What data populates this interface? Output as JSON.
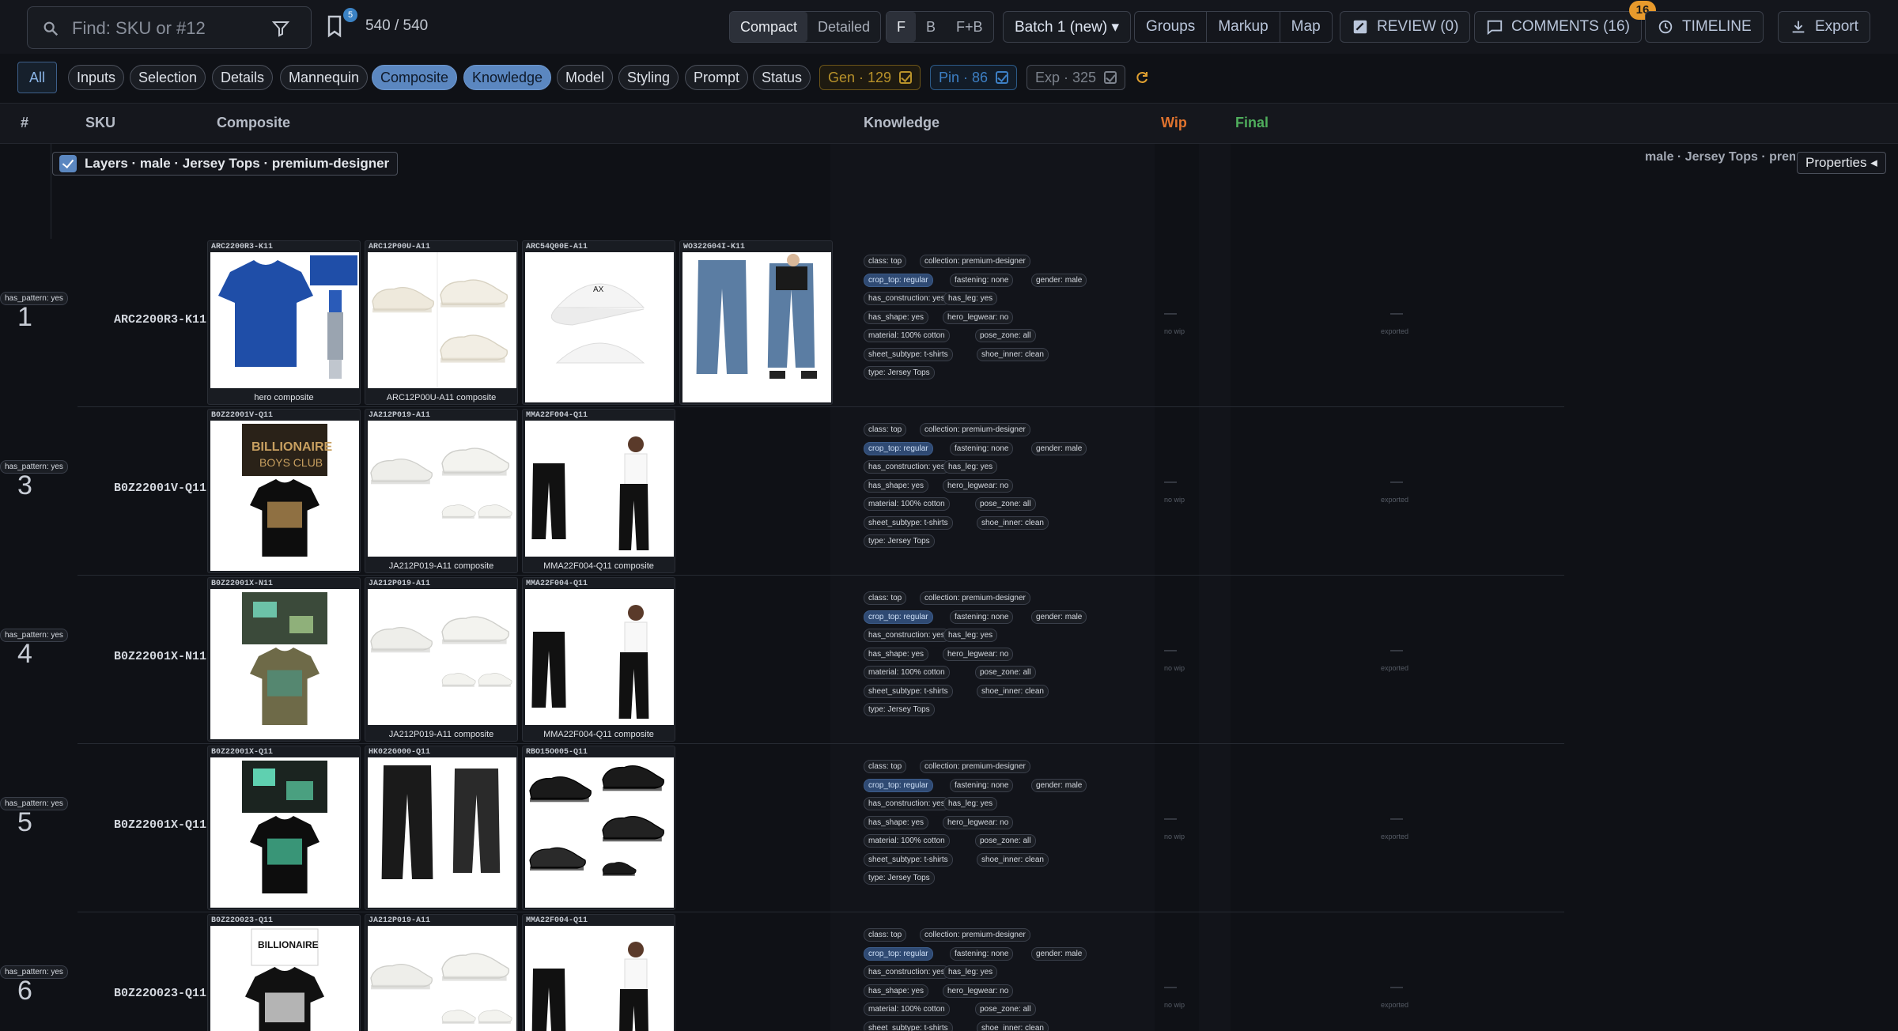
{
  "search": {
    "placeholder": "Find: SKU or #12"
  },
  "bookmarks": {
    "badge": "5"
  },
  "count": "540 / 540",
  "view_mode": {
    "compact": "Compact",
    "detailed": "Detailed"
  },
  "side": {
    "f": "F",
    "b": "B",
    "fb": "F+B"
  },
  "batch": "Batch 1 (new) ▾",
  "groups": {
    "groups": "Groups",
    "markup": "Markup",
    "map": "Map"
  },
  "review": "REVIEW (0)",
  "comments": {
    "label": "COMMENTS (16)",
    "badge": "16"
  },
  "timeline": "TIMELINE",
  "export": "Export",
  "filters": {
    "all": "All",
    "chips": [
      "Inputs",
      "Selection",
      "Details",
      "Mannequin",
      "Composite",
      "Knowledge",
      "Model",
      "Styling",
      "Prompt",
      "Status"
    ],
    "gen": "Gen · 129",
    "pin": "Pin · 86",
    "exp": "Exp · 325"
  },
  "columns": {
    "num": "#",
    "sku": "SKU",
    "composite": "Composite",
    "knowledge": "Knowledge",
    "wip": "Wip",
    "final": "Final"
  },
  "colors": {
    "wip": "#e0732e",
    "final": "#4fae5c",
    "accent": "#5b87c0",
    "gen": "#b8922a",
    "pin": "#3d7fc4",
    "exp": "#8a8f99"
  },
  "group": {
    "layers": "Layers · male · Jersey Tops · premium-designer",
    "crumb": "male · Jersey Tops · premium-designer",
    "properties": "Properties ◂"
  },
  "knowledge_tags": [
    "class: top",
    "collection: premium-designer",
    "crop_top: regular",
    "fastening: none",
    "gender: male",
    "has_construction: yes",
    "has_leg: yes",
    "has_pattern: yes",
    "has_shape: yes",
    "hero_legwear: no",
    "material: 100% cotton",
    "pose_zone: all",
    "sheet_subtype: t-shirts",
    "shoe_inner: clean",
    "type: Jersey Tops"
  ],
  "status": {
    "wip_dash": "—",
    "wip_text": "no wip",
    "final_dash": "—",
    "final_text": "exported"
  },
  "rows": [
    {
      "num": "1",
      "sku": "ARC2200R3-K11",
      "cards": [
        {
          "label": "ARC2200R3-K11",
          "caption": "hero composite"
        },
        {
          "label": "ARC12P00U-A11",
          "caption": "ARC12P00U-A11 composite"
        },
        {
          "label": "ARC54Q00E-A11",
          "caption": ""
        },
        {
          "label": "WO322G04I-K11",
          "caption": ""
        }
      ]
    },
    {
      "num": "3",
      "sku": "B0Z22001V-Q11",
      "cards": [
        {
          "label": "B0Z22001V-Q11",
          "caption": ""
        },
        {
          "label": "JA212P019-A11",
          "caption": "JA212P019-A11 composite"
        },
        {
          "label": "MMA22F004-Q11",
          "caption": "MMA22F004-Q11 composite"
        }
      ]
    },
    {
      "num": "4",
      "sku": "B0Z22001X-N11",
      "cards": [
        {
          "label": "B0Z22001X-N11",
          "caption": ""
        },
        {
          "label": "JA212P019-A11",
          "caption": "JA212P019-A11 composite"
        },
        {
          "label": "MMA22F004-Q11",
          "caption": "MMA22F004-Q11 composite"
        }
      ]
    },
    {
      "num": "5",
      "sku": "B0Z22001X-Q11",
      "cards": [
        {
          "label": "B0Z22001X-Q11",
          "caption": ""
        },
        {
          "label": "HK022G000-Q11",
          "caption": ""
        },
        {
          "label": "RBO15O005-Q11",
          "caption": ""
        }
      ]
    },
    {
      "num": "6",
      "sku": "B0Z22O023-Q11",
      "cards": [
        {
          "label": "B0Z22O023-Q11",
          "caption": ""
        },
        {
          "label": "JA212P019-A11",
          "caption": ""
        },
        {
          "label": "MMA22F004-Q11",
          "caption": ""
        }
      ]
    }
  ]
}
